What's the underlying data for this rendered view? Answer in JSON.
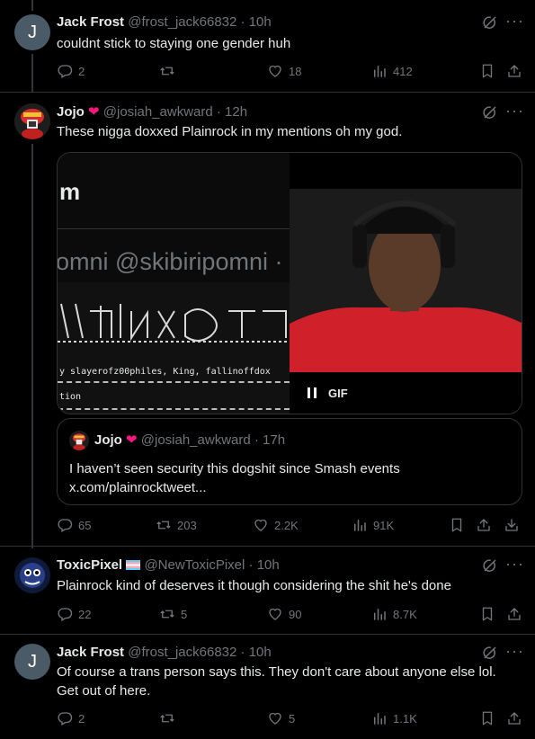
{
  "tweets": [
    {
      "avatar_letter": "J",
      "name": "Jack Frost",
      "handle": "@frost_jack66832",
      "time": "· 10h",
      "text": "couldnt stick to staying one gender huh",
      "replies": "2",
      "reposts": "",
      "likes": "18",
      "views": "412"
    },
    {
      "name": "Jojo",
      "handle": "@josiah_awkward",
      "time": "· 12h",
      "text": "These nigga doxxed Plainrock in my mentions oh my god.",
      "replies": "65",
      "reposts": "203",
      "likes": "2.2K",
      "views": "91K",
      "media": {
        "screenshot_handle": "omni @skibiripomni ·",
        "screenshot_header": "m",
        "screenshot_line1": "y slayerofz00philes, King, fallinoffdox",
        "screenshot_line2": "tion",
        "gif_label": "GIF"
      },
      "quote": {
        "name": "Jojo",
        "handle": "@josiah_awkward",
        "time": "· 17h",
        "text": "I haven’t seen security this dogshit since Smash events",
        "link": "x.com/plainrocktweet..."
      }
    },
    {
      "name": "ToxicPixel",
      "handle": "@NewToxicPixel",
      "time": "· 10h",
      "text": "Plainrock kind of deserves it though considering the shit he's done",
      "replies": "22",
      "reposts": "5",
      "likes": "90",
      "views": "8.7K"
    },
    {
      "avatar_letter": "J",
      "name": "Jack Frost",
      "handle": "@frost_jack66832",
      "time": "· 10h",
      "text": "Of course a trans person says this. They don't care about anyone else lol. Get out of here.",
      "replies": "2",
      "reposts": "",
      "likes": "5",
      "views": "1.1K"
    }
  ],
  "colors": {
    "bg": "#000000",
    "text": "#e7e9ea",
    "muted": "#71767b",
    "border": "#2f3336",
    "heart": "#f91880"
  },
  "icons": [
    "reply-icon",
    "repost-icon",
    "like-icon",
    "views-icon",
    "bookmark-icon",
    "share-icon",
    "download-icon",
    "grok-icon",
    "more-icon",
    "heart-emoji-icon",
    "trans-flag-icon",
    "pause-icon"
  ]
}
